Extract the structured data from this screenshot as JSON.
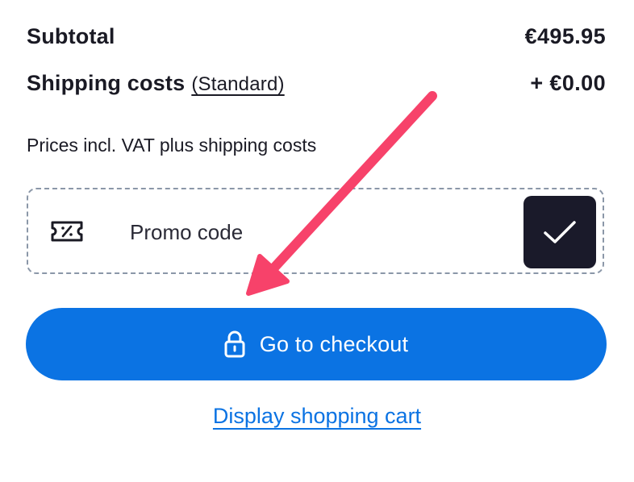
{
  "summary": {
    "subtotal_label": "Subtotal",
    "subtotal_value": "€495.95",
    "shipping_label": "Shipping costs",
    "shipping_method": "(Standard)",
    "shipping_value": "+ €0.00",
    "vat_note": "Prices incl. VAT plus shipping costs"
  },
  "promo": {
    "placeholder": "Promo code",
    "icon": "ticket-percent-icon",
    "submit_icon": "checkmark-icon"
  },
  "actions": {
    "checkout_label": "Go to checkout",
    "checkout_icon": "lock-icon",
    "cart_link_label": "Display shopping cart"
  },
  "colors": {
    "primary_blue": "#0b73e3",
    "dark_button": "#1a1a2a",
    "annotation_arrow": "#f7426a",
    "text": "#1a1a24",
    "dashed_border": "#8b97a8"
  }
}
